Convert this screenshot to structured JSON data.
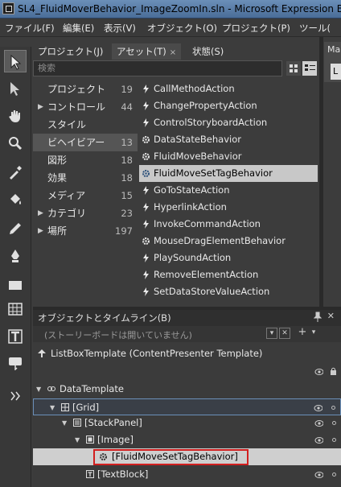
{
  "window": {
    "title": "SL4_FluidMoverBehavior_ImageZoomIn.sln - Microsoft Expression B"
  },
  "menu": [
    "ファイル(F)",
    "編集(E)",
    "表示(V)",
    "オブジェクト(O)",
    "プロジェクト(P)",
    "ツール("
  ],
  "tabs": [
    {
      "label": "プロジェクト(J)"
    },
    {
      "label": "アセット(T)",
      "close": "×"
    },
    {
      "label": "状態(S)"
    }
  ],
  "right_pane": {
    "tab": "Ma",
    "sub": "L"
  },
  "assets": {
    "search_placeholder": "検索",
    "categories": [
      {
        "label": "プロジェクト",
        "count": "19"
      },
      {
        "label": "コントロール",
        "count": "44",
        "expander": "▶"
      },
      {
        "label": "スタイル",
        "count": ""
      },
      {
        "label": "ビヘイビアー",
        "count": "13"
      },
      {
        "label": "図形",
        "count": "18"
      },
      {
        "label": "効果",
        "count": "18"
      },
      {
        "label": "メディア",
        "count": "15"
      },
      {
        "label": "カテゴリ",
        "count": "23",
        "expander": "▶"
      },
      {
        "label": "場所",
        "count": "197",
        "expander": "▶"
      }
    ],
    "items": [
      "CallMethodAction",
      "ChangePropertyAction",
      "ControlStoryboardAction",
      "DataStateBehavior",
      "FluidMoveBehavior",
      "FluidMoveSetTagBehavior",
      "GoToStateAction",
      "HyperlinkAction",
      "InvokeCommandAction",
      "MouseDragElementBehavior",
      "PlaySoundAction",
      "RemoveElementAction",
      "SetDataStoreValueAction"
    ],
    "selected_item": "FluidMoveSetTagBehavior"
  },
  "objects": {
    "title": "オブジェクトとタイムライン(B)",
    "storyboard_text": "(ストーリーボードは開いていません)",
    "template": "ListBoxTemplate (ContentPresenter Template)",
    "tree": [
      {
        "label": "DataTemplate"
      },
      {
        "label": "[Grid]"
      },
      {
        "label": "[StackPanel]"
      },
      {
        "label": "[Image]"
      },
      {
        "label": "[FluidMoveSetTagBehavior]"
      },
      {
        "label": "[TextBlock]"
      }
    ]
  }
}
